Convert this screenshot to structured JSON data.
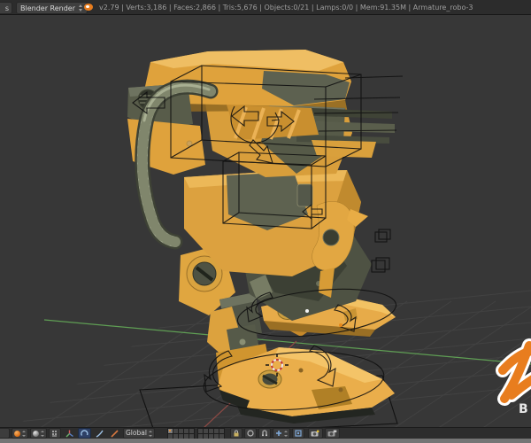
{
  "header": {
    "left_fragment": "s",
    "render_engine": "Blender Render",
    "stats": "v2.79 | Verts:3,186 | Faces:2,866 | Tris:5,676 | Objects:0/21 | Lamps:0/0 | Mem:91.35M | Armature_robo-3"
  },
  "viewport": {
    "content": "textured yellow-and-olive mech robot in pose mode with black armature custom-shape overlays (boxes, arrows, foot ellipses), floor grid, green Y axis, red X axis, 3D cursor",
    "watermark_letter": "B"
  },
  "toolbar": {
    "transform_orientation": "Global",
    "icons": [
      "editor-type",
      "interaction-mode",
      "viewport-shading",
      "pivot-point",
      "manipulator-pointer",
      "manipulator-translate",
      "manipulator-rotate",
      "manipulator-scale",
      "layer-toggles",
      "lock-to-scene",
      "proportional-editing",
      "snap-element",
      "snap-target",
      "opengl-render-still",
      "opengl-render-anim"
    ],
    "layers": {
      "groups": 2,
      "cols": 5,
      "rows": 2,
      "active_index": 0
    }
  },
  "colors": {
    "accent_orange": "#E87D1E",
    "mech_yellow": "#E2A540",
    "mech_olive": "#585C4A",
    "viewport_bg": "#373737",
    "axis_green": "#5F9E54",
    "axis_red": "#8E4A45"
  }
}
